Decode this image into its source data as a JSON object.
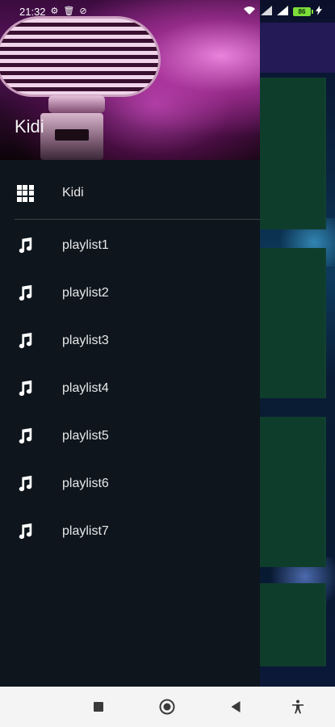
{
  "status_bar": {
    "time": "21:32",
    "left_icons": [
      "gear-icon",
      "trash-icon",
      "circle-slash-icon"
    ],
    "right_icons": [
      "wifi-icon",
      "signal-icon",
      "signal-icon",
      "battery-icon",
      "charging-icon"
    ],
    "battery_level": "86"
  },
  "drawer": {
    "header_title": "Kidi",
    "home_item": {
      "label": "Kidi",
      "icon": "grid-icon"
    },
    "playlists": [
      {
        "label": "playlist1",
        "icon": "music-note-icon"
      },
      {
        "label": "playlist2",
        "icon": "music-note-icon"
      },
      {
        "label": "playlist3",
        "icon": "music-note-icon"
      },
      {
        "label": "playlist4",
        "icon": "music-note-icon"
      },
      {
        "label": "playlist5",
        "icon": "music-note-icon"
      },
      {
        "label": "playlist6",
        "icon": "music-note-icon"
      },
      {
        "label": "playlist7",
        "icon": "music-note-icon"
      }
    ]
  },
  "nav_bar": {
    "buttons": [
      "recents-button",
      "home-button",
      "back-button",
      "accessibility-button"
    ]
  },
  "colors": {
    "drawer_bg": "#0e151c",
    "divider": "#3a4147",
    "battery": "#7ddc3a",
    "nav_bg": "#f4f4f4"
  }
}
